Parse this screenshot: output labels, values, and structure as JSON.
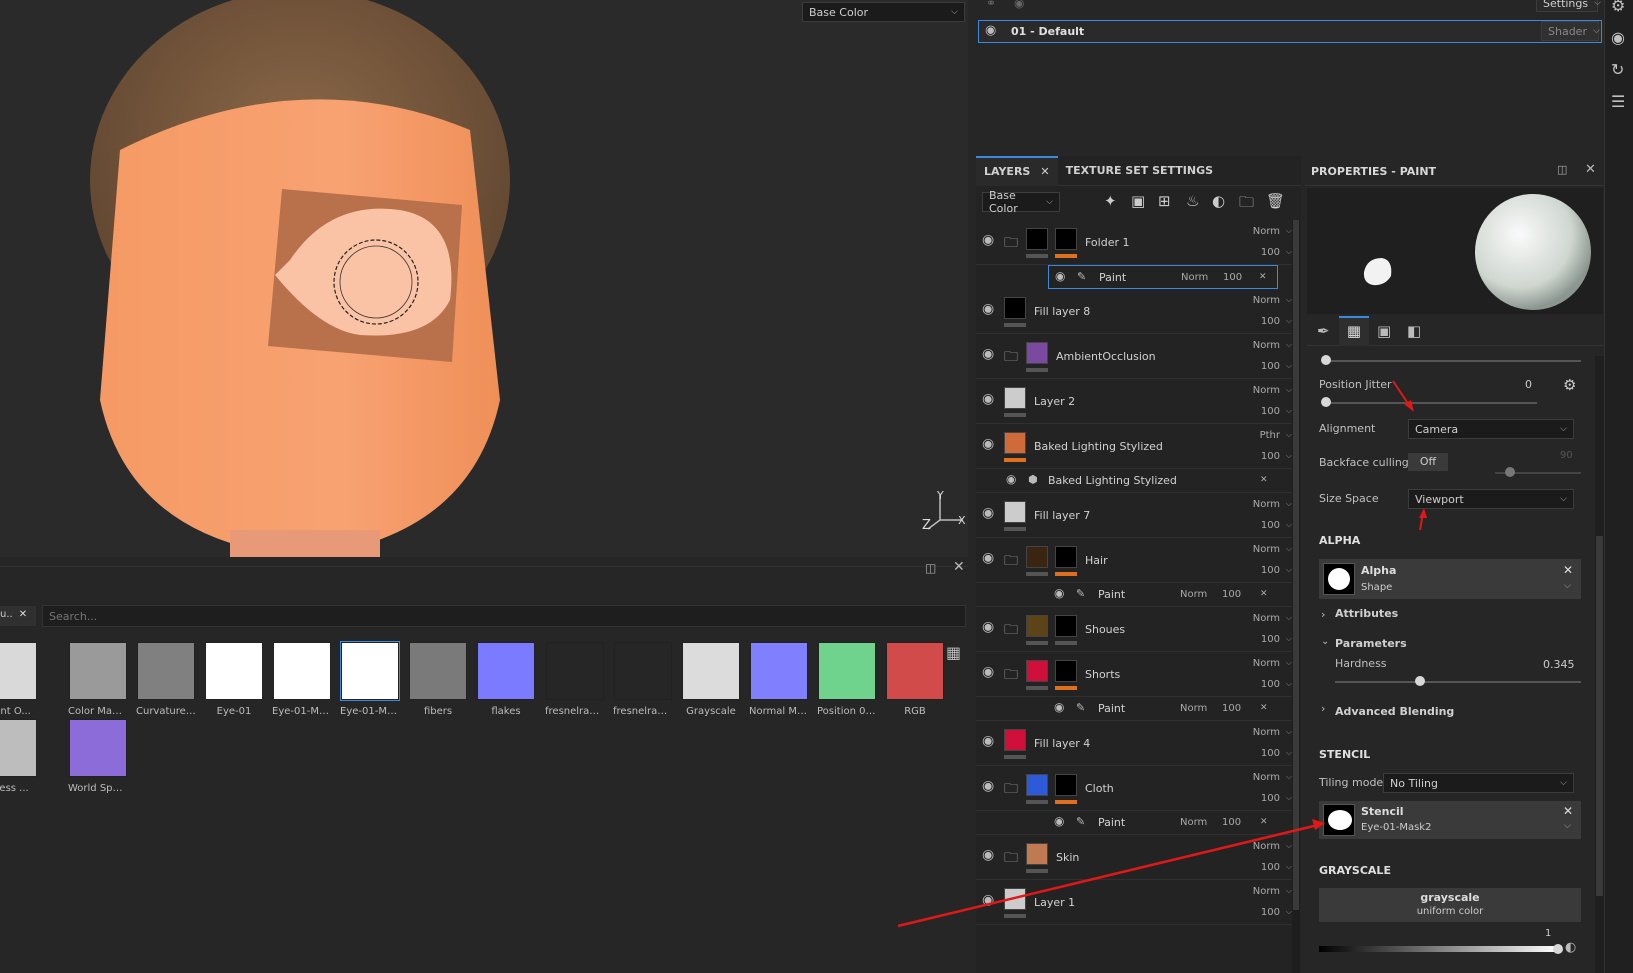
{
  "viewport": {
    "channel_select": "Base Color",
    "axis": {
      "y": "Y",
      "z": "Z",
      "x": "X"
    }
  },
  "shelf": {
    "search_placeholder": "Search...",
    "items": [
      {
        "label": "bient O...",
        "color": "#d9d9d9"
      },
      {
        "label": "Color Map f...",
        "color": "#9a9a9a"
      },
      {
        "label": "Curvature ...",
        "color": "#808080"
      },
      {
        "label": "Eye-01",
        "color": "#ffffff"
      },
      {
        "label": "Eye-01-Mask",
        "color": "#ffffff"
      },
      {
        "label": "Eye-01-Mas...",
        "color": "#ffffff"
      },
      {
        "label": "fibers",
        "color": "#7a7a7a"
      },
      {
        "label": "flakes",
        "color": "#7b7bff"
      },
      {
        "label": "fresnelranges",
        "color": "#262626"
      },
      {
        "label": "fresnelrang...",
        "color": "#262626"
      },
      {
        "label": "Grayscale",
        "color": "#dcdcdc"
      },
      {
        "label": "Normal Ma...",
        "color": "#8080ff"
      },
      {
        "label": "Position 01 ...",
        "color": "#6fd38e"
      },
      {
        "label": "RGB",
        "color": "#d24b4b"
      },
      {
        "label": "kness ...",
        "color": "#bdbdbd"
      },
      {
        "label": "World Spac...",
        "color": "#8c6cd8"
      }
    ]
  },
  "texture_set": {
    "name": "01 - Default",
    "shader_label": "Shader",
    "settings_label": "Settings"
  },
  "layers_panel": {
    "tab_layers": "LAYERS",
    "tab_texture_set": "TEXTURE SET SETTINGS",
    "channel": "Base Color",
    "layers": [
      {
        "name": "Folder 1",
        "blend": "Norm",
        "opacity": "100",
        "folder": true,
        "thumb": "#000000",
        "mask": "#000000",
        "orange": true
      },
      {
        "name": "Paint",
        "blend": "Norm",
        "opacity": "100",
        "sub": true
      },
      {
        "name": "Fill layer 8",
        "blend": "Norm",
        "opacity": "100",
        "thumb": "#000000"
      },
      {
        "name": "AmbientOcclusion",
        "blend": "Norm",
        "opacity": "100",
        "folder": true,
        "thumb": "#7a4aa0"
      },
      {
        "name": "Layer 2",
        "blend": "Norm",
        "opacity": "100",
        "thumb": "#cccccc"
      },
      {
        "name": "Baked Lighting Stylized",
        "blend": "Pthr",
        "opacity": "100",
        "thumb": "#d06a3a",
        "orange": true
      },
      {
        "name": "Baked Lighting Stylized",
        "sub": true,
        "filter": true
      },
      {
        "name": "Fill layer 7",
        "blend": "Norm",
        "opacity": "100",
        "thumb": "#cccccc"
      },
      {
        "name": "Hair",
        "blend": "Norm",
        "opacity": "100",
        "folder": true,
        "thumb": "#3a2412",
        "mask": "#000000",
        "orange": true
      },
      {
        "name": "Paint",
        "blend": "Norm",
        "opacity": "100",
        "sub": true
      },
      {
        "name": "Shoues",
        "blend": "Norm",
        "opacity": "100",
        "folder": true,
        "thumb": "#5c4418",
        "mask": "#000000"
      },
      {
        "name": "Shorts",
        "blend": "Norm",
        "opacity": "100",
        "folder": true,
        "thumb": "#d0103a",
        "mask": "#000000",
        "orange": true
      },
      {
        "name": "Paint",
        "blend": "Norm",
        "opacity": "100",
        "sub": true
      },
      {
        "name": "Fill layer 4",
        "blend": "Norm",
        "opacity": "100",
        "thumb": "#d0103a"
      },
      {
        "name": "Cloth",
        "blend": "Norm",
        "opacity": "100",
        "folder": true,
        "thumb": "#2c5ad8",
        "mask": "#000000",
        "orange": true
      },
      {
        "name": "Paint",
        "blend": "Norm",
        "opacity": "100",
        "sub": true
      },
      {
        "name": "Skin",
        "blend": "Norm",
        "opacity": "100",
        "folder": true,
        "thumb": "#c07a52"
      },
      {
        "name": "Layer 1",
        "blend": "Norm",
        "opacity": "100",
        "thumb": "#cccccc"
      }
    ]
  },
  "properties": {
    "title": "PROPERTIES - PAINT",
    "position_jitter_label": "Position Jitter",
    "position_jitter_value": "0",
    "alignment_label": "Alignment",
    "alignment_value": "Camera",
    "backface_label": "Backface culling",
    "backface_value": "Off",
    "backface_angle": "90",
    "size_space_label": "Size Space",
    "size_space_value": "Viewport",
    "alpha_header": "ALPHA",
    "alpha_name": "Alpha",
    "alpha_shape": "Shape",
    "attributes_label": "Attributes",
    "parameters_label": "Parameters",
    "hardness_label": "Hardness",
    "hardness_value": "0.345",
    "advanced_blending_label": "Advanced Blending",
    "stencil_header": "STENCIL",
    "tiling_label": "Tiling mode",
    "tiling_value": "No Tiling",
    "stencil_name": "Stencil",
    "stencil_resource": "Eye-01-Mask2",
    "grayscale_header": "GRAYSCALE",
    "grayscale_title": "grayscale",
    "grayscale_sub": "uniform color",
    "grayscale_value": "1"
  }
}
